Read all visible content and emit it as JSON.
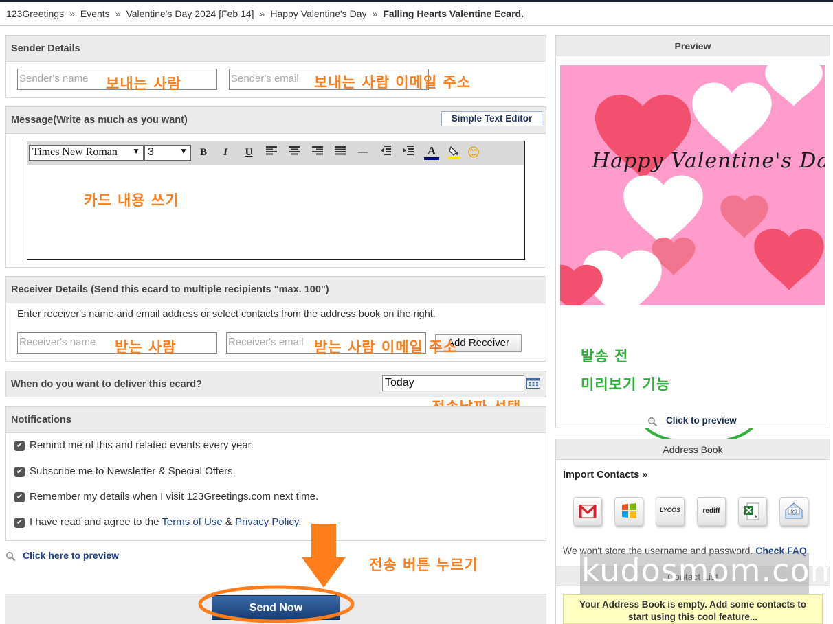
{
  "breadcrumb": [
    "123Greetings",
    "Events",
    "Valentine's Day 2024 [Feb 14]",
    "Happy Valentine's Day",
    "Falling Hearts Valentine Ecard."
  ],
  "breadcrumb_sep": "»",
  "sender": {
    "heading": "Sender Details",
    "name_placeholder": "Sender's name",
    "email_placeholder": "Sender's email"
  },
  "message": {
    "heading": "Message(Write as much as you want)",
    "simple_editor_label": "Simple Text Editor",
    "font_value": "Times New Roman",
    "size_value": "3",
    "toolbar": {
      "bold": "B",
      "italic": "I",
      "underline": "U",
      "hr": "—",
      "color": "A",
      "emoji": "😊"
    }
  },
  "receiver": {
    "heading": "Receiver Details (Send this ecard to multiple recipients \"max. 100\")",
    "instructions": "Enter receiver's name and email address or select contacts from the address book on the right.",
    "name_placeholder": "Receiver's name",
    "email_placeholder": "Receiver's email",
    "add_button": "Add Receiver"
  },
  "deliver": {
    "question": "When do you want to deliver this ecard?",
    "value": "Today"
  },
  "notifications": {
    "heading": "Notifications",
    "items": [
      "Remind me of this and related events every year.",
      "Subscribe me to Newsletter & Special Offers.",
      "Remember my details when I visit 123Greetings.com next time."
    ],
    "terms_prefix": "I have read and agree to the ",
    "terms_link": "Terms of Use",
    "terms_amp": " & ",
    "privacy_link": "Privacy Policy",
    "terms_suffix": "."
  },
  "preview_link": "Click here to preview",
  "send_button": "Send Now",
  "preview": {
    "heading": "Preview",
    "card_text": "Happy Valentine's Day!",
    "click_to_preview": "Click to preview"
  },
  "address_book": {
    "heading": "Address Book",
    "import_label": "Import Contacts »",
    "providers": [
      "gmail",
      "windows-live",
      "lycos",
      "rediff",
      "excel",
      "email"
    ],
    "lycos_label": "LYCOS",
    "rediff_label": "rediff",
    "privacy_note": "We won't store the username and password.",
    "faq_link": "Check FAQ",
    "contact_list_heading": "Contact List",
    "empty_message": "Your Address Book is empty. Add some contacts to start using this cool feature..."
  },
  "annotations": {
    "sender_name": "보내는 사람",
    "sender_email": "보내는 사람 이메일 주소",
    "card_content": "카드 내용 쓰기",
    "receiver_name": "받는 사람",
    "receiver_email": "받는 사람 이메일 주소",
    "date_select": "전송날짜 선택",
    "send_press": "전송 버튼 누르기",
    "preview_line1": "발송 전",
    "preview_line2": "미리보기 기능"
  },
  "watermark": "kudosmom.com",
  "colors": {
    "orange_annotation": "#ff7d1a",
    "green_annotation": "#2eb03a",
    "send_button": "#1d4f8c",
    "card_pink": "#ff9ccb"
  }
}
